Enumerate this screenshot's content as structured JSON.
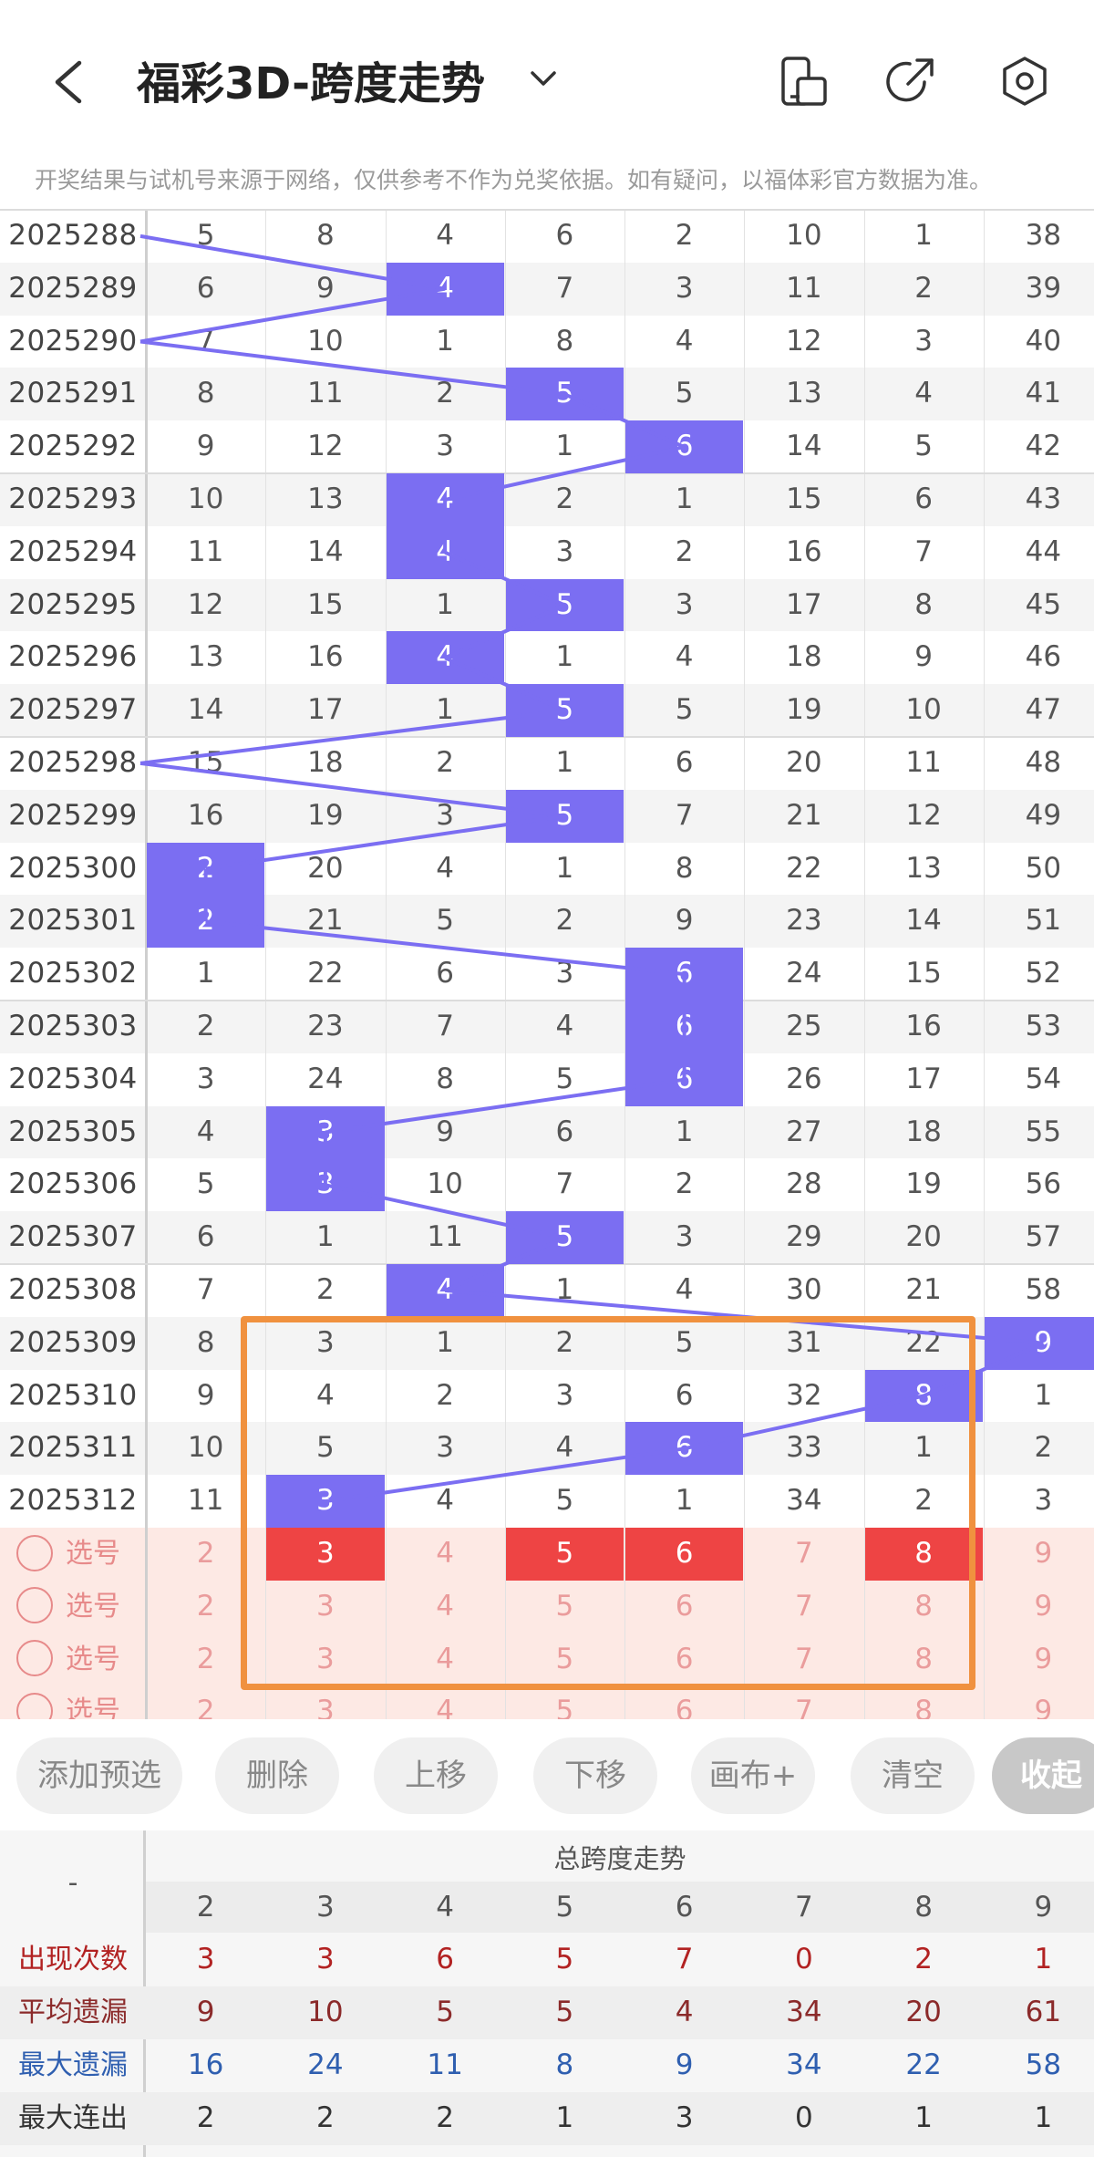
{
  "header": {
    "title": "福彩3D-跨度走势",
    "back_icon": "chevron-left-icon",
    "caret_icon": "chevron-down-icon",
    "icons": [
      "phone-layout-icon",
      "share-arrow-icon",
      "settings-hexagon-icon"
    ]
  },
  "notice": "开奖结果与试机号来源于网络，仅供参考不作为兑奖依据。如有疑问，以福体彩官方数据为准。",
  "columns": [
    "2",
    "3",
    "4",
    "5",
    "6",
    "7",
    "8",
    "9"
  ],
  "rows": [
    {
      "period": "2025288",
      "values": [
        "5",
        "8",
        "4",
        "6",
        "2",
        "10",
        "1",
        "38"
      ],
      "hit": null
    },
    {
      "period": "2025289",
      "values": [
        "6",
        "9",
        "4",
        "7",
        "3",
        "11",
        "2",
        "39"
      ],
      "hit": 2
    },
    {
      "period": "2025290",
      "values": [
        "7",
        "10",
        "1",
        "8",
        "4",
        "12",
        "3",
        "40"
      ],
      "hit": null
    },
    {
      "period": "2025291",
      "values": [
        "8",
        "11",
        "2",
        "5",
        "5",
        "13",
        "4",
        "41"
      ],
      "hit": 3
    },
    {
      "period": "2025292",
      "values": [
        "9",
        "12",
        "3",
        "1",
        "6",
        "14",
        "5",
        "42"
      ],
      "hit": 4
    },
    {
      "period": "2025293",
      "values": [
        "10",
        "13",
        "4",
        "2",
        "1",
        "15",
        "6",
        "43"
      ],
      "hit": 2
    },
    {
      "period": "2025294",
      "values": [
        "11",
        "14",
        "4",
        "3",
        "2",
        "16",
        "7",
        "44"
      ],
      "hit": 2
    },
    {
      "period": "2025295",
      "values": [
        "12",
        "15",
        "1",
        "5",
        "3",
        "17",
        "8",
        "45"
      ],
      "hit": 3
    },
    {
      "period": "2025296",
      "values": [
        "13",
        "16",
        "4",
        "1",
        "4",
        "18",
        "9",
        "46"
      ],
      "hit": 2
    },
    {
      "period": "2025297",
      "values": [
        "14",
        "17",
        "1",
        "5",
        "5",
        "19",
        "10",
        "47"
      ],
      "hit": 3
    },
    {
      "period": "2025298",
      "values": [
        "15",
        "18",
        "2",
        "1",
        "6",
        "20",
        "11",
        "48"
      ],
      "hit": null
    },
    {
      "period": "2025299",
      "values": [
        "16",
        "19",
        "3",
        "5",
        "7",
        "21",
        "12",
        "49"
      ],
      "hit": 3
    },
    {
      "period": "2025300",
      "values": [
        "2",
        "20",
        "4",
        "1",
        "8",
        "22",
        "13",
        "50"
      ],
      "hit": 0
    },
    {
      "period": "2025301",
      "values": [
        "2",
        "21",
        "5",
        "2",
        "9",
        "23",
        "14",
        "51"
      ],
      "hit": 0
    },
    {
      "period": "2025302",
      "values": [
        "1",
        "22",
        "6",
        "3",
        "6",
        "24",
        "15",
        "52"
      ],
      "hit": 4
    },
    {
      "period": "2025303",
      "values": [
        "2",
        "23",
        "7",
        "4",
        "6",
        "25",
        "16",
        "53"
      ],
      "hit": 4
    },
    {
      "period": "2025304",
      "values": [
        "3",
        "24",
        "8",
        "5",
        "6",
        "26",
        "17",
        "54"
      ],
      "hit": 4
    },
    {
      "period": "2025305",
      "values": [
        "4",
        "3",
        "9",
        "6",
        "1",
        "27",
        "18",
        "55"
      ],
      "hit": 1
    },
    {
      "period": "2025306",
      "values": [
        "5",
        "3",
        "10",
        "7",
        "2",
        "28",
        "19",
        "56"
      ],
      "hit": 1
    },
    {
      "period": "2025307",
      "values": [
        "6",
        "1",
        "11",
        "5",
        "3",
        "29",
        "20",
        "57"
      ],
      "hit": 3
    },
    {
      "period": "2025308",
      "values": [
        "7",
        "2",
        "4",
        "1",
        "4",
        "30",
        "21",
        "58"
      ],
      "hit": 2
    },
    {
      "period": "2025309",
      "values": [
        "8",
        "3",
        "1",
        "2",
        "5",
        "31",
        "22",
        "9"
      ],
      "hit": 7
    },
    {
      "period": "2025310",
      "values": [
        "9",
        "4",
        "2",
        "3",
        "6",
        "32",
        "8",
        "1"
      ],
      "hit": 6
    },
    {
      "period": "2025311",
      "values": [
        "10",
        "5",
        "3",
        "4",
        "6",
        "33",
        "1",
        "2"
      ],
      "hit": 4
    },
    {
      "period": "2025312",
      "values": [
        "11",
        "3",
        "4",
        "5",
        "1",
        "34",
        "2",
        "3"
      ],
      "hit": 1
    }
  ],
  "selection_rows": [
    {
      "label": "选号",
      "values": [
        "2",
        "3",
        "4",
        "5",
        "6",
        "7",
        "8",
        "9"
      ],
      "selected": [
        1,
        3,
        4,
        6
      ]
    },
    {
      "label": "选号",
      "values": [
        "2",
        "3",
        "4",
        "5",
        "6",
        "7",
        "8",
        "9"
      ],
      "selected": []
    },
    {
      "label": "选号",
      "values": [
        "2",
        "3",
        "4",
        "5",
        "6",
        "7",
        "8",
        "9"
      ],
      "selected": []
    },
    {
      "label": "选号",
      "values": [
        "2",
        "3",
        "4",
        "5",
        "6",
        "7",
        "8",
        "9"
      ],
      "selected": []
    }
  ],
  "toolbar": {
    "buttons": [
      "添加预选",
      "删除",
      "上移",
      "下移",
      "画布+",
      "清空"
    ],
    "collapse": "收起"
  },
  "stats": {
    "corner": "-",
    "title": "总跨度走势",
    "columns": [
      "2",
      "3",
      "4",
      "5",
      "6",
      "7",
      "8",
      "9"
    ],
    "rows": [
      {
        "label": "出现次数",
        "color": "#b22222",
        "values": [
          "3",
          "3",
          "6",
          "5",
          "7",
          "0",
          "2",
          "1"
        ]
      },
      {
        "label": "平均遗漏",
        "color": "#8b2a2a",
        "values": [
          "9",
          "10",
          "5",
          "5",
          "4",
          "34",
          "20",
          "61"
        ]
      },
      {
        "label": "最大遗漏",
        "color": "#2f5fb0",
        "values": [
          "16",
          "24",
          "11",
          "8",
          "9",
          "34",
          "22",
          "58"
        ]
      },
      {
        "label": "最大连出",
        "color": "#333333",
        "values": [
          "2",
          "2",
          "2",
          "1",
          "3",
          "0",
          "1",
          "1"
        ]
      }
    ]
  },
  "colors": {
    "hit": "#7b6ef2",
    "selected": "#ee4444",
    "box": "#f0913f"
  }
}
